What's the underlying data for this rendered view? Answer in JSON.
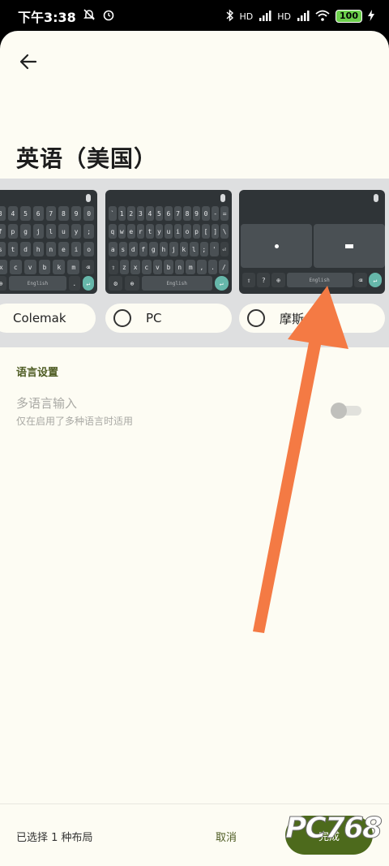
{
  "status": {
    "time": "下午3:38",
    "battery": "100",
    "hd1": "HD",
    "hd2": "HD"
  },
  "header": {
    "title": "英语（美国）"
  },
  "layouts": [
    {
      "label": "Colemak"
    },
    {
      "label": "PC"
    },
    {
      "label": "摩斯"
    }
  ],
  "keyboards": {
    "space_label": "English",
    "colemak_rows": [
      [
        "3",
        "4",
        "5",
        "6",
        "7",
        "8",
        "9",
        "0"
      ],
      [
        "f",
        "p",
        "g",
        "j",
        "l",
        "u",
        "y",
        ";"
      ],
      [
        "s",
        "t",
        "d",
        "h",
        "n",
        "e",
        "i",
        "o"
      ],
      [
        "x",
        "c",
        "v",
        "b",
        "k",
        "m",
        "⌫"
      ]
    ],
    "pc_rows": [
      [
        "`",
        "1",
        "2",
        "3",
        "4",
        "5",
        "6",
        "7",
        "8",
        "9",
        "0",
        "-",
        "="
      ],
      [
        "q",
        "w",
        "e",
        "r",
        "t",
        "y",
        "u",
        "i",
        "o",
        "p",
        "[",
        "]",
        "\\"
      ],
      [
        "a",
        "s",
        "d",
        "f",
        "g",
        "h",
        "j",
        "k",
        "l",
        ";",
        "'",
        "⏎"
      ],
      [
        "⇧",
        "z",
        "x",
        "c",
        "v",
        "b",
        "n",
        "m",
        ",",
        ".",
        "/"
      ]
    ]
  },
  "section": {
    "label": "语言设置"
  },
  "setting": {
    "title": "多语言输入",
    "subtitle": "仅在启用了多种语言时适用"
  },
  "bottom": {
    "selected_count": "已选择 1 种布局",
    "cancel_label": "取消",
    "done_label": "完成"
  },
  "watermark": {
    "text": "PC768"
  },
  "colors": {
    "accent": "#4d6a1c",
    "annotation_arrow": "#f47a44"
  }
}
